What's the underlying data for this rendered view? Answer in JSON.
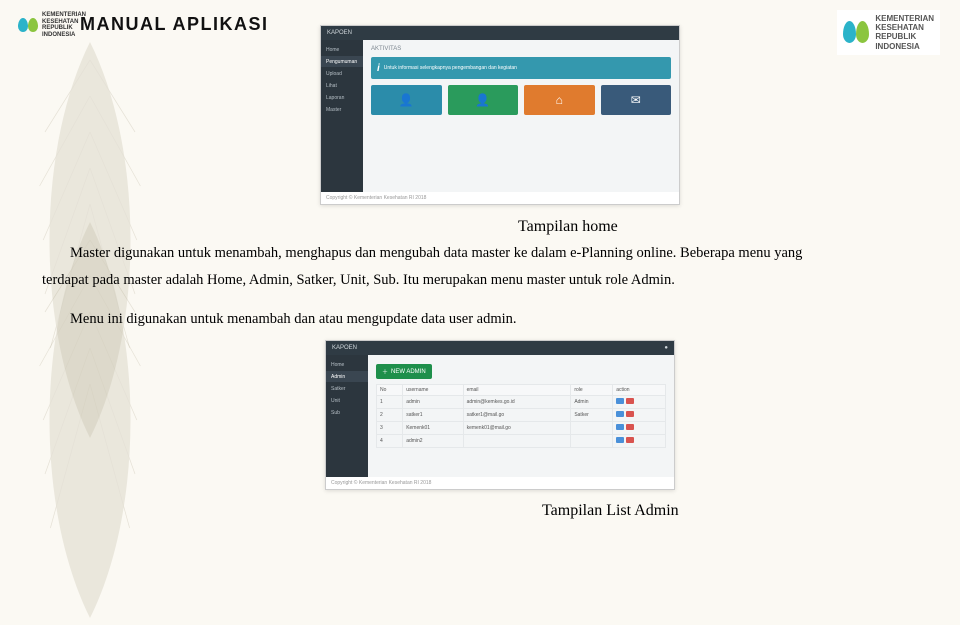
{
  "header": {
    "left_logo_text": "KEMENTERIAN\nKESEHATAN\nREPUBLIK\nINDONESIA",
    "title": "MANUAL APLIKASI",
    "right_logo_text": "KEMENTERIAN\nKESEHATAN\nREPUBLIK\nINDONESIA"
  },
  "screenshot_home": {
    "topbar_left": "KAPOEN",
    "breadcrumb": "AKTIVITAS",
    "sidebar": [
      "Home",
      "Pengumuman",
      "Upload",
      "Lihat",
      "Laporan",
      "Master"
    ],
    "info_text": "Untuk informasi selengkapnya pengembangan dan kegiatan",
    "tile_colors": [
      "#2b8caa",
      "#2a9b5c",
      "#e07b2e",
      "#395a7a"
    ],
    "tile_icons": [
      "person-icon",
      "person-icon",
      "home-icon",
      "mail-icon"
    ],
    "footer": "Copyright © Kementerian Kesehatan RI 2018"
  },
  "screenshot_admin": {
    "topbar_left": "KAPOEN",
    "sidebar": [
      "Home",
      "Admin",
      "Satker",
      "Unit",
      "Sub"
    ],
    "new_button": "NEW ADMIN",
    "table": {
      "headers": [
        "No",
        "username",
        "email",
        "role",
        "action"
      ],
      "rows": [
        [
          "1",
          "admin",
          "admin@kemkes.go.id",
          "Admin",
          ""
        ],
        [
          "2",
          "satker1",
          "satker1@mail.go",
          "Satker",
          ""
        ],
        [
          "3",
          "Kemenk01",
          "kemenk01@mail.go",
          "",
          ""
        ],
        [
          "4",
          "admin2",
          "",
          "",
          ""
        ]
      ]
    },
    "footer": "Copyright © Kementerian Kesehatan RI 2018"
  },
  "captions": {
    "home": "Tampilan home",
    "admin": "Tampilan List Admin"
  },
  "paragraphs": {
    "p1": "Master digunakan untuk menambah, menghapus dan mengubah data master ke dalam e-Planning online. Beberapa menu yang",
    "p1b": "terdapat pada master adalah Home, Admin, Satker, Unit, Sub. Itu merupakan menu master untuk role Admin.",
    "p2": "Menu ini digunakan untuk menambah dan atau mengupdate data user admin."
  }
}
